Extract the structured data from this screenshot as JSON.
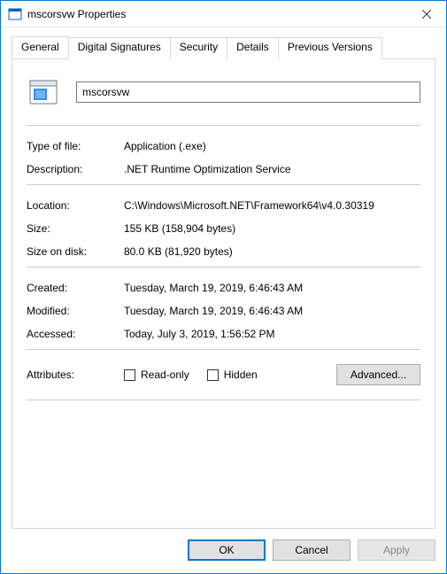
{
  "window": {
    "title": "mscorsvw Properties"
  },
  "tabs": {
    "general": "General",
    "digital_signatures": "Digital Signatures",
    "security": "Security",
    "details": "Details",
    "previous_versions": "Previous Versions"
  },
  "general": {
    "filename": "mscorsvw",
    "labels": {
      "type_of_file": "Type of file:",
      "description": "Description:",
      "location": "Location:",
      "size": "Size:",
      "size_on_disk": "Size on disk:",
      "created": "Created:",
      "modified": "Modified:",
      "accessed": "Accessed:",
      "attributes": "Attributes:"
    },
    "values": {
      "type_of_file": "Application (.exe)",
      "description": ".NET Runtime Optimization Service",
      "location": "C:\\Windows\\Microsoft.NET\\Framework64\\v4.0.30319",
      "size": "155 KB (158,904 bytes)",
      "size_on_disk": "80.0 KB (81,920 bytes)",
      "created": "Tuesday, March 19, 2019, 6:46:43 AM",
      "modified": "Tuesday, March 19, 2019, 6:46:43 AM",
      "accessed": "Today, July 3, 2019, 1:56:52 PM"
    },
    "attributes": {
      "read_only_label": "Read-only",
      "hidden_label": "Hidden",
      "read_only_checked": false,
      "hidden_checked": false
    },
    "advanced_button": "Advanced..."
  },
  "buttons": {
    "ok": "OK",
    "cancel": "Cancel",
    "apply": "Apply"
  },
  "icons": {
    "app_icon": "application-icon",
    "close": "close-icon",
    "file": "exe-file-icon"
  }
}
